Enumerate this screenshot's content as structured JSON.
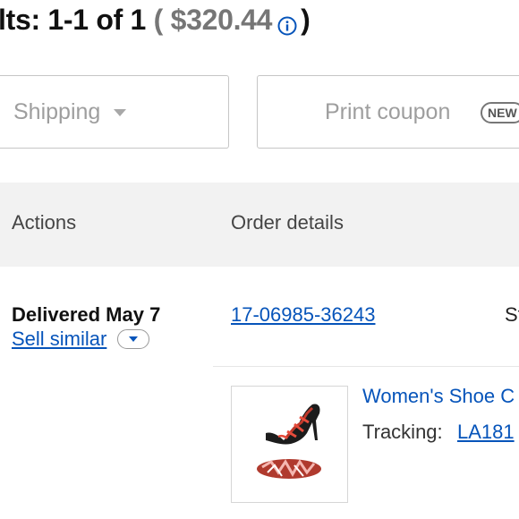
{
  "header": {
    "results_text": "lts: 1-1 of 1",
    "paren_open": "(",
    "total": "$320.44",
    "paren_close": ")"
  },
  "filters": {
    "shipping_label": "Shipping",
    "print_coupon_label": "Print coupon",
    "new_badge": "NEW"
  },
  "table": {
    "columns": [
      "Actions",
      "Order details"
    ]
  },
  "order": {
    "status": "Delivered May 7",
    "sell_similar": "Sell similar",
    "order_number": "17-06985-36243",
    "status_column_partial": "St",
    "item": {
      "title": "Women's Shoe C",
      "tracking_label": "Tracking:",
      "tracking_number": "LA181"
    }
  },
  "colors": {
    "link": "#0654ba",
    "header_bg": "#f2f2f2",
    "muted_text": "#9e9e9e"
  },
  "icons": {
    "info": "info-icon",
    "shipping_dropdown": "caret-down-icon",
    "sell_similar_toggle": "chevron-down-icon"
  }
}
